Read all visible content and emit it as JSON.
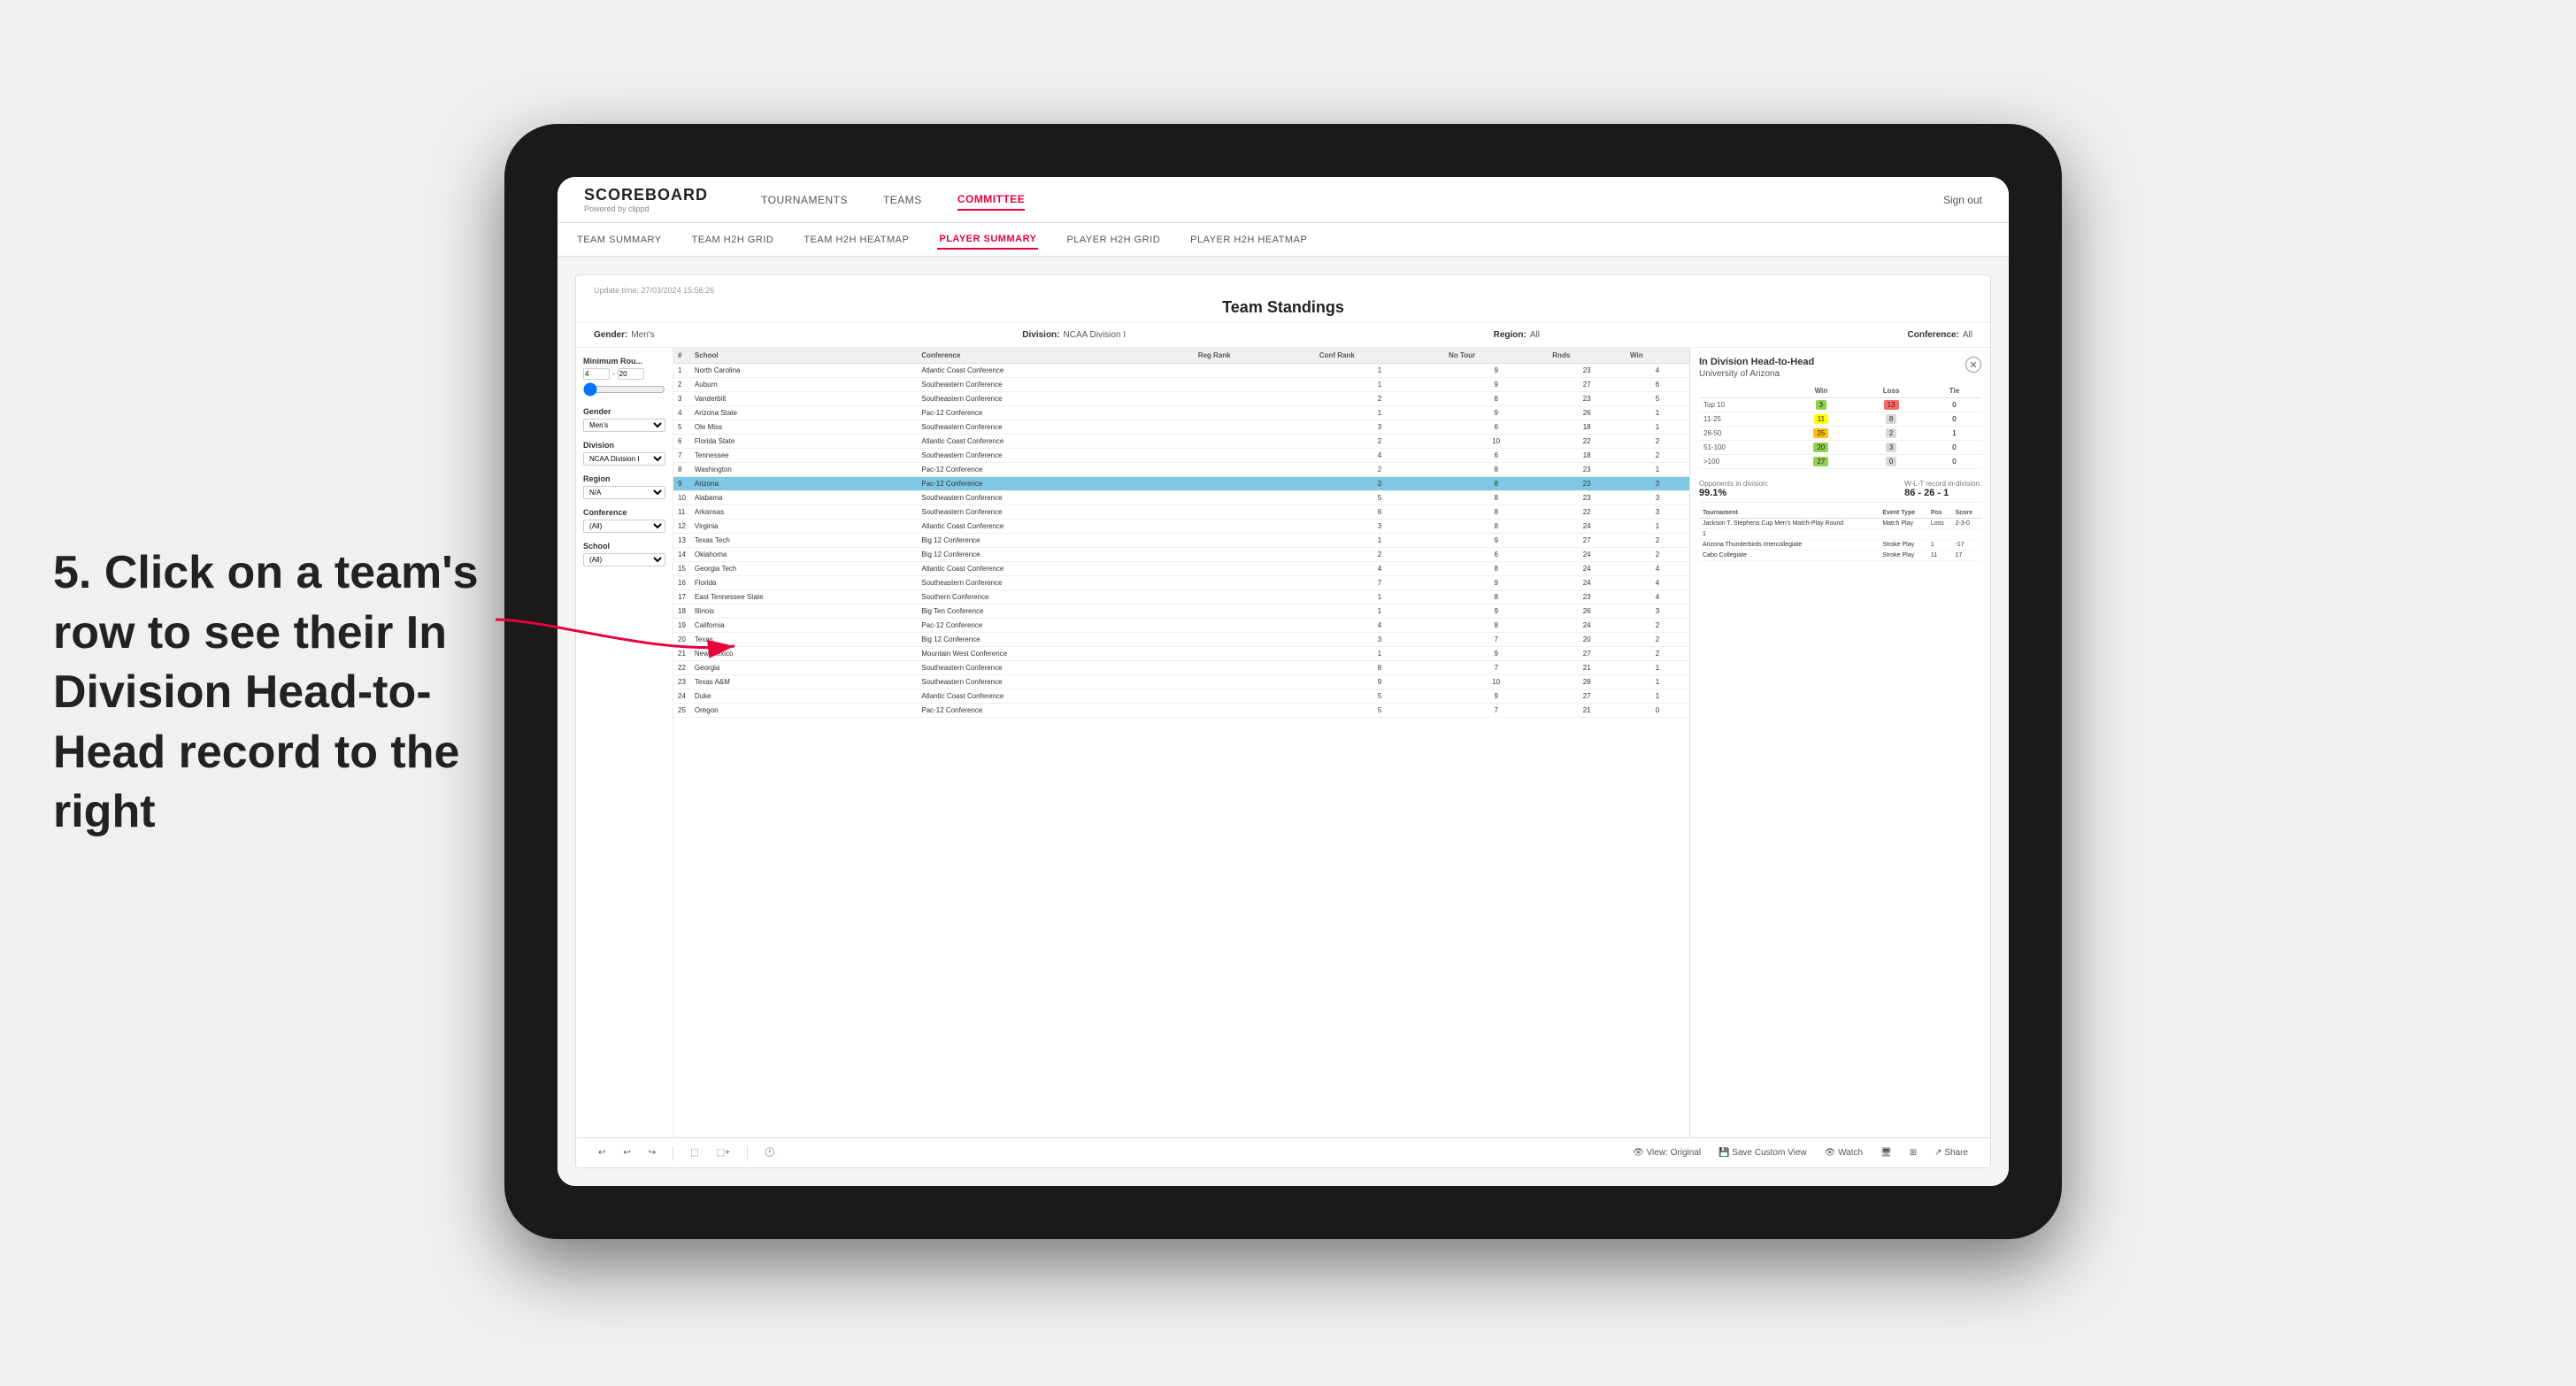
{
  "annotation": {
    "text": "5. Click on a team's row to see their In Division Head-to-Head record to the right"
  },
  "top_nav": {
    "logo": "SCOREBOARD",
    "logo_sub": "Powered by clippd",
    "items": [
      "TOURNAMENTS",
      "TEAMS",
      "COMMITTEE"
    ],
    "active_item": "COMMITTEE",
    "sign_out": "Sign out"
  },
  "sub_nav": {
    "items": [
      "TEAM SUMMARY",
      "TEAM H2H GRID",
      "TEAM H2H HEATMAP",
      "PLAYER SUMMARY",
      "PLAYER H2H GRID",
      "PLAYER H2H HEATMAP"
    ],
    "active_item": "PLAYER SUMMARY"
  },
  "panel": {
    "update_time": "Update time: 27/03/2024 15:56:26",
    "title": "Team Standings",
    "filters_row": {
      "gender_label": "Gender:",
      "gender_value": "Men's",
      "division_label": "Division:",
      "division_value": "NCAA Division I",
      "region_label": "Region:",
      "region_value": "All",
      "conference_label": "Conference:",
      "conference_value": "All"
    },
    "sidebar": {
      "min_rounds_label": "Minimum Rou...",
      "min_rounds_value": "4",
      "min_rounds_max": "20",
      "gender_label": "Gender",
      "gender_selected": "Men's",
      "division_label": "Division",
      "division_selected": "NCAA Division I",
      "region_label": "Region",
      "region_selected": "N/A",
      "conference_label": "Conference",
      "conference_selected": "(All)",
      "school_label": "School",
      "school_selected": "(All)"
    },
    "table": {
      "headers": [
        "#",
        "School",
        "Conference",
        "Reg Rank",
        "Conf Rank",
        "No Tour",
        "Rnds",
        "Win"
      ],
      "rows": [
        {
          "num": 1,
          "school": "North Carolina",
          "conference": "Atlantic Coast Conference",
          "reg_rank": "",
          "conf_rank": 1,
          "no_tour": 9,
          "rnds": 23,
          "win": 4
        },
        {
          "num": 2,
          "school": "Auburn",
          "conference": "Southeastern Conference",
          "reg_rank": "",
          "conf_rank": 1,
          "no_tour": 9,
          "rnds": 27,
          "win": 6
        },
        {
          "num": 3,
          "school": "Vanderbilt",
          "conference": "Southeastern Conference",
          "reg_rank": "",
          "conf_rank": 2,
          "no_tour": 8,
          "rnds": 23,
          "win": 5
        },
        {
          "num": 4,
          "school": "Arizona State",
          "conference": "Pac-12 Conference",
          "reg_rank": "",
          "conf_rank": 1,
          "no_tour": 9,
          "rnds": 26,
          "win": 1
        },
        {
          "num": 5,
          "school": "Ole Miss",
          "conference": "Southeastern Conference",
          "reg_rank": "",
          "conf_rank": 3,
          "no_tour": 6,
          "rnds": 18,
          "win": 1
        },
        {
          "num": 6,
          "school": "Florida State",
          "conference": "Atlantic Coast Conference",
          "reg_rank": "",
          "conf_rank": 2,
          "no_tour": 10,
          "rnds": 22,
          "win": 2
        },
        {
          "num": 7,
          "school": "Tennessee",
          "conference": "Southeastern Conference",
          "reg_rank": "",
          "conf_rank": 4,
          "no_tour": 6,
          "rnds": 18,
          "win": 2
        },
        {
          "num": 8,
          "school": "Washington",
          "conference": "Pac-12 Conference",
          "reg_rank": "",
          "conf_rank": 2,
          "no_tour": 8,
          "rnds": 23,
          "win": 1
        },
        {
          "num": 9,
          "school": "Arizona",
          "conference": "Pac-12 Conference",
          "reg_rank": "",
          "conf_rank": 3,
          "no_tour": 8,
          "rnds": 23,
          "win": 3,
          "highlighted": true
        },
        {
          "num": 10,
          "school": "Alabama",
          "conference": "Southeastern Conference",
          "reg_rank": "",
          "conf_rank": 5,
          "no_tour": 8,
          "rnds": 23,
          "win": 3
        },
        {
          "num": 11,
          "school": "Arkansas",
          "conference": "Southeastern Conference",
          "reg_rank": "",
          "conf_rank": 6,
          "no_tour": 8,
          "rnds": 22,
          "win": 3
        },
        {
          "num": 12,
          "school": "Virginia",
          "conference": "Atlantic Coast Conference",
          "reg_rank": "",
          "conf_rank": 3,
          "no_tour": 8,
          "rnds": 24,
          "win": 1
        },
        {
          "num": 13,
          "school": "Texas Tech",
          "conference": "Big 12 Conference",
          "reg_rank": "",
          "conf_rank": 1,
          "no_tour": 9,
          "rnds": 27,
          "win": 2
        },
        {
          "num": 14,
          "school": "Oklahoma",
          "conference": "Big 12 Conference",
          "reg_rank": "",
          "conf_rank": 2,
          "no_tour": 6,
          "rnds": 24,
          "win": 2
        },
        {
          "num": 15,
          "school": "Georgia Tech",
          "conference": "Atlantic Coast Conference",
          "reg_rank": "",
          "conf_rank": 4,
          "no_tour": 8,
          "rnds": 24,
          "win": 4
        },
        {
          "num": 16,
          "school": "Florida",
          "conference": "Southeastern Conference",
          "reg_rank": "",
          "conf_rank": 7,
          "no_tour": 9,
          "rnds": 24,
          "win": 4
        },
        {
          "num": 17,
          "school": "East Tennessee State",
          "conference": "Southern Conference",
          "reg_rank": "",
          "conf_rank": 1,
          "no_tour": 8,
          "rnds": 23,
          "win": 4
        },
        {
          "num": 18,
          "school": "Illinois",
          "conference": "Big Ten Conference",
          "reg_rank": "",
          "conf_rank": 1,
          "no_tour": 9,
          "rnds": 26,
          "win": 3
        },
        {
          "num": 19,
          "school": "California",
          "conference": "Pac-12 Conference",
          "reg_rank": "",
          "conf_rank": 4,
          "no_tour": 8,
          "rnds": 24,
          "win": 2
        },
        {
          "num": 20,
          "school": "Texas",
          "conference": "Big 12 Conference",
          "reg_rank": "",
          "conf_rank": 3,
          "no_tour": 7,
          "rnds": 20,
          "win": 2
        },
        {
          "num": 21,
          "school": "New Mexico",
          "conference": "Mountain West Conference",
          "reg_rank": "",
          "conf_rank": 1,
          "no_tour": 9,
          "rnds": 27,
          "win": 2
        },
        {
          "num": 22,
          "school": "Georgia",
          "conference": "Southeastern Conference",
          "reg_rank": "",
          "conf_rank": 8,
          "no_tour": 7,
          "rnds": 21,
          "win": 1
        },
        {
          "num": 23,
          "school": "Texas A&M",
          "conference": "Southeastern Conference",
          "reg_rank": "",
          "conf_rank": 9,
          "no_tour": 10,
          "rnds": 28,
          "win": 1
        },
        {
          "num": 24,
          "school": "Duke",
          "conference": "Atlantic Coast Conference",
          "reg_rank": "",
          "conf_rank": 5,
          "no_tour": 9,
          "rnds": 27,
          "win": 1
        },
        {
          "num": 25,
          "school": "Oregon",
          "conference": "Pac-12 Conference",
          "reg_rank": "",
          "conf_rank": 5,
          "no_tour": 7,
          "rnds": 21,
          "win": 0
        }
      ]
    },
    "h2h": {
      "title": "In Division Head-to-Head",
      "team": "University of Arizona",
      "table_headers": [
        "",
        "Win",
        "Loss",
        "Tie"
      ],
      "rows": [
        {
          "range": "Top 10",
          "win": 3,
          "loss": 13,
          "tie": 0,
          "win_color": "green",
          "loss_color": "red"
        },
        {
          "range": "11-25",
          "win": 11,
          "loss": 8,
          "tie": 0,
          "win_color": "yellow",
          "loss_color": "gray"
        },
        {
          "range": "26-50",
          "win": 25,
          "loss": 2,
          "tie": 1,
          "win_color": "orange",
          "loss_color": "gray"
        },
        {
          "range": "51-100",
          "win": 20,
          "loss": 3,
          "tie": 0,
          "win_color": "green",
          "loss_color": "gray"
        },
        {
          "range": ">100",
          "win": 27,
          "loss": 0,
          "tie": 0,
          "win_color": "green",
          "loss_color": "gray"
        }
      ],
      "opponents_label": "Opponents in division:",
      "opponents_value": "99.1%",
      "record_label": "W-L-T record in-division:",
      "record_value": "86 - 26 - 1",
      "tournament_label": "Tournament",
      "tournament_headers": [
        "Tournament",
        "Event Type",
        "Pos",
        "Score"
      ],
      "tournament_rows": [
        {
          "name": "Jackson T. Stephens Cup Men's Match-Play Round",
          "type": "Match Play",
          "result": "Loss",
          "score": "2-3-0"
        },
        {
          "name": "1",
          "type": "",
          "result": "",
          "score": ""
        },
        {
          "name": "Arizona Thunderbirds Intercollegiate",
          "type": "Stroke Play",
          "result": "1",
          "score": "-17"
        },
        {
          "name": "Cabo Collegiate",
          "type": "Stroke Play",
          "result": "11",
          "score": "17"
        }
      ]
    }
  },
  "toolbar": {
    "undo": "↩",
    "redo": "↪",
    "view_original": "View: Original",
    "save_custom": "Save Custom View",
    "watch": "Watch",
    "share": "Share"
  }
}
